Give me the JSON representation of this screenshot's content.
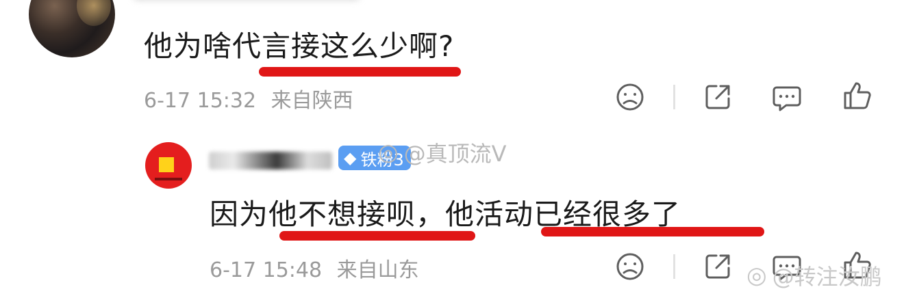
{
  "comment1": {
    "text": "他为啥代言接这么少啊?",
    "timestamp": "6-17 15:32",
    "location": "来自陕西"
  },
  "reply": {
    "badge": "铁粉3",
    "text": "因为他不想接呗，他活动已经很多了",
    "timestamp": "6-17 15:48",
    "location": "来自山东"
  },
  "watermarks": {
    "top": "@真顶流V",
    "bottom": "@转注汝鹏"
  },
  "actions": [
    "sad-face-icon",
    "share-icon",
    "comment-icon",
    "like-icon"
  ],
  "colors": {
    "underline": "#e01616",
    "badge": "#5b9ef2",
    "meta_text": "#9a9a9a"
  }
}
